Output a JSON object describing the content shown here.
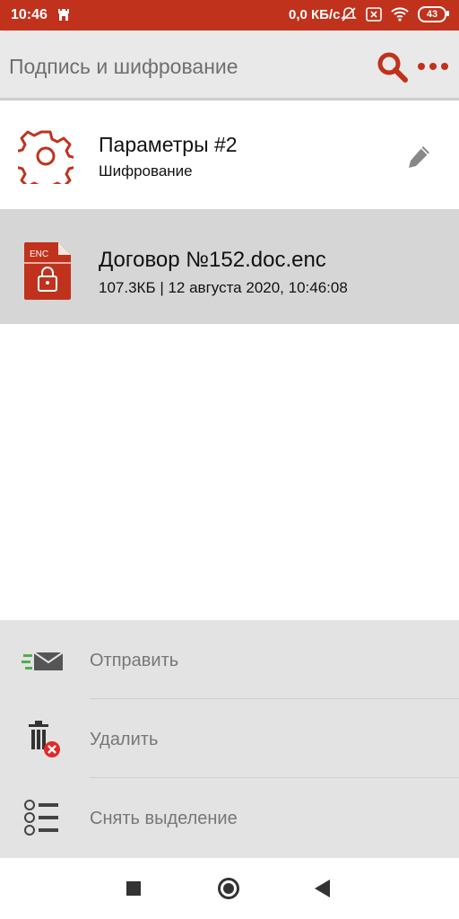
{
  "status_bar": {
    "time": "10:46",
    "network_speed": "0,0 КБ/с",
    "battery_level": "43",
    "icons": [
      "castle-icon",
      "mute-bell-icon",
      "sim-x-icon",
      "wifi-icon",
      "battery-icon"
    ]
  },
  "app_bar": {
    "title": "Подпись и шифрование",
    "icons": [
      "search-icon",
      "more-icon"
    ],
    "accent_color": "#c0321c"
  },
  "params_item": {
    "title": "Параметры #2",
    "subtitle": "Шифрование",
    "icons": [
      "gear-icon",
      "pencil-icon"
    ]
  },
  "file_item": {
    "icon_label": "ENC",
    "name": "Договор №152.doc.enc",
    "meta": "107.3КБ | 12 августа 2020, 10:46:08",
    "selected_bg": "#d6d6d6"
  },
  "actions": {
    "send_label": "Отправить",
    "delete_label": "Удалить",
    "deselect_label": "Снять выделение"
  },
  "nav_bar": {
    "icons": [
      "recents-square-icon",
      "home-circle-icon",
      "back-triangle-icon"
    ]
  }
}
